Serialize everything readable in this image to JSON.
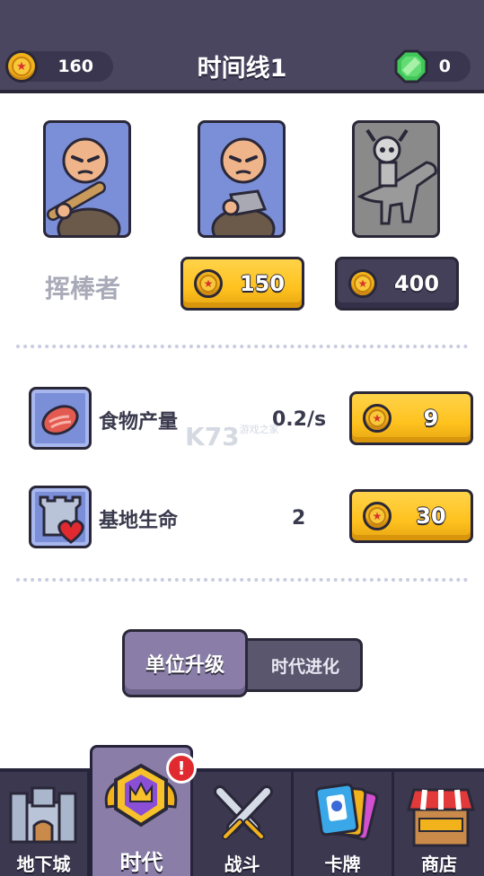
{
  "header": {
    "title": "时间线1",
    "coins": "160",
    "gems": "0"
  },
  "units": {
    "selected_name": "挥棒者",
    "cards": [
      {
        "icon": "club-caveman-icon"
      },
      {
        "icon": "rock-caveman-icon"
      },
      {
        "icon": "skeleton-dino-rider-icon"
      }
    ],
    "prices": [
      {
        "amount": "150",
        "state": "available"
      },
      {
        "amount": "400",
        "state": "locked"
      }
    ]
  },
  "stats": [
    {
      "label": "食物产量",
      "value": "0.2/s",
      "cost": "9",
      "icon": "meat-icon"
    },
    {
      "label": "基地生命",
      "value": "2",
      "cost": "30",
      "icon": "castle-heart-icon"
    }
  ],
  "toggle": {
    "active": "单位升级",
    "inactive": "时代进化"
  },
  "nav": [
    {
      "label": "地下城",
      "icon": "castle-icon"
    },
    {
      "label": "时代",
      "icon": "crown-badge-icon",
      "active": true,
      "badge": "!"
    },
    {
      "label": "战斗",
      "icon": "crossed-swords-icon"
    },
    {
      "label": "卡牌",
      "icon": "cards-icon"
    },
    {
      "label": "商店",
      "icon": "shop-icon"
    }
  ],
  "watermark": {
    "text": "K73",
    "sub": "游戏之家"
  },
  "colors": {
    "header": "#4a4660",
    "accent_yellow": "#ffc21e",
    "card_blue": "#7b8ed8",
    "active_tab": "#8a7ea8",
    "nav_bg": "#3b3850"
  }
}
